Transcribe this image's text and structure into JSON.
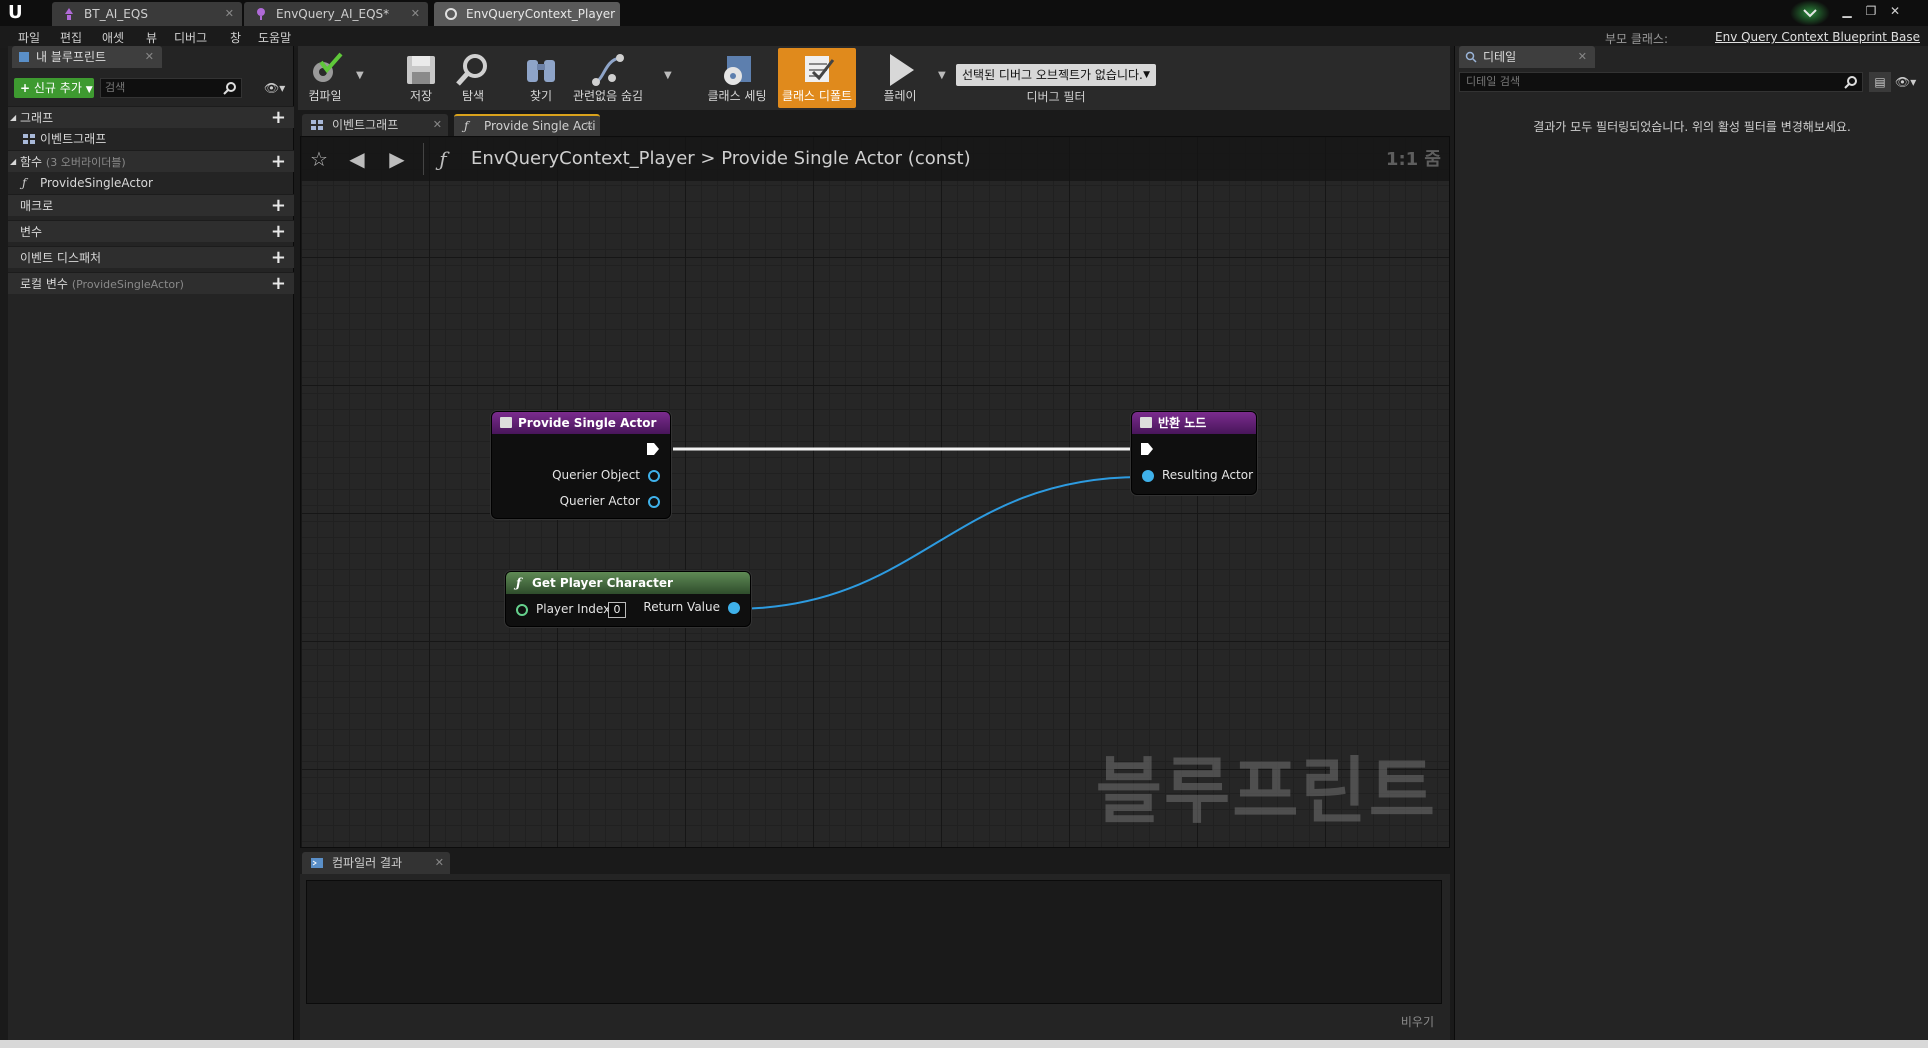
{
  "window": {
    "tabs": [
      {
        "label": "BT_AI_EQS"
      },
      {
        "label": "EnvQuery_AI_EQS*"
      },
      {
        "label": "EnvQueryContext_Player"
      }
    ]
  },
  "menu": {
    "items": [
      "파일",
      "편집",
      "애셋",
      "뷰",
      "디버그",
      "창",
      "도움말"
    ],
    "parent_class_label": "부모 클래스:",
    "parent_class_value": "Env Query Context Blueprint Base"
  },
  "my_blueprint": {
    "tab_label": "내 블루프린트",
    "add_new_label": "신규 추가",
    "search_placeholder": "검색",
    "sections": {
      "graphs": "그래프",
      "graphs_item": "이벤트그래프",
      "functions": "함수",
      "functions_note": "(3 오버라이더블)",
      "functions_item": "ProvideSingleActor",
      "macros": "매크로",
      "variables": "변수",
      "dispatchers": "이벤트 디스패처",
      "local_vars": "로컬 변수",
      "local_vars_note": "(ProvideSingleActor)"
    }
  },
  "toolbar": {
    "compile": "컴파일",
    "save": "저장",
    "browse": "탐색",
    "find": "찾기",
    "hide_unrelated": "관련없음 숨김",
    "class_settings": "클래스 세팅",
    "class_defaults": "클래스 디폴트",
    "play": "플레이",
    "debug_object": "선택된 디버그 오브젝트가 없습니다.",
    "debug_filter": "디버그 필터"
  },
  "graph_tabs": [
    {
      "label": "이벤트그래프"
    },
    {
      "label": "Provide Single Acti"
    }
  ],
  "graph": {
    "breadcrumb_root": "EnvQueryContext_Player",
    "breadcrumb_sep": ">",
    "breadcrumb_current": "Provide Single Actor (const)",
    "zoom": "1:1 줌",
    "watermark": "블루프린트",
    "nodes": {
      "entry": {
        "title": "Provide Single Actor",
        "pins": [
          "Querier Object",
          "Querier Actor"
        ]
      },
      "return": {
        "title": "반환 노드",
        "pins": [
          "Resulting Actor"
        ]
      },
      "get_player": {
        "title": "Get Player Character",
        "input": "Player Index",
        "index_value": "0",
        "output": "Return Value"
      }
    }
  },
  "compiler": {
    "tab_label": "컴파일러 결과",
    "clear_label": "비우기"
  },
  "details": {
    "tab_label": "디테일",
    "search_placeholder": "디테일 검색",
    "empty_message": "결과가 모두 필터링되었습니다. 위의 활성 필터를 변경해보세요."
  },
  "colors": {
    "accent_orange": "#e08a1c",
    "add_green": "#3e9a30",
    "pin_blue": "#3fb1ea",
    "function_purple": "#7b2c8e",
    "pure_green": "#5f8a55"
  }
}
